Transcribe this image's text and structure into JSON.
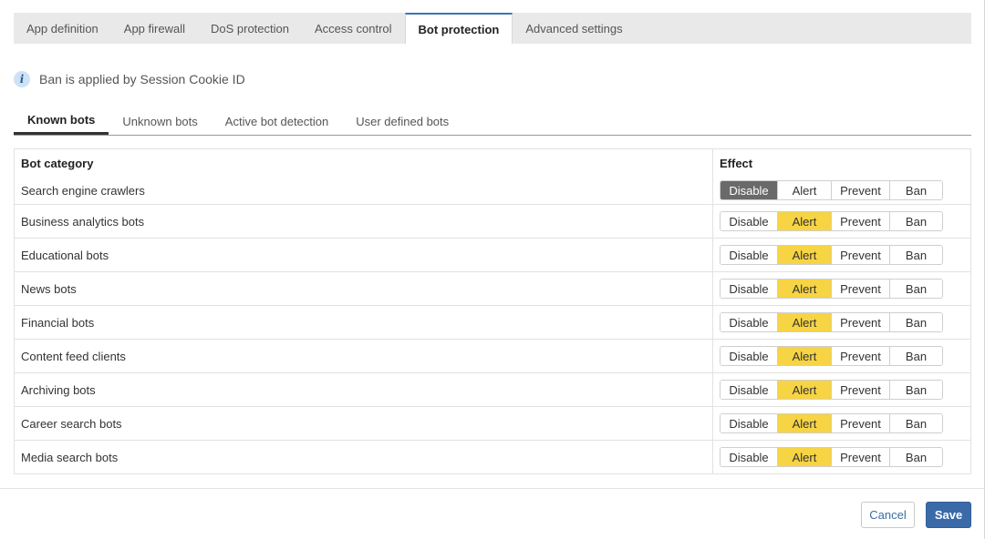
{
  "top_tabs": [
    {
      "label": "App definition"
    },
    {
      "label": "App firewall"
    },
    {
      "label": "DoS protection"
    },
    {
      "label": "Access control"
    },
    {
      "label": "Bot protection",
      "active": true
    },
    {
      "label": "Advanced settings"
    }
  ],
  "info": {
    "icon": "info-icon",
    "text": "Ban is applied by Session Cookie ID"
  },
  "sub_tabs": [
    {
      "label": "Known bots",
      "active": true
    },
    {
      "label": "Unknown bots"
    },
    {
      "label": "Active bot detection"
    },
    {
      "label": "User defined bots"
    }
  ],
  "table": {
    "headers": {
      "category": "Bot category",
      "effect": "Effect"
    },
    "effect_options": [
      "Disable",
      "Alert",
      "Prevent",
      "Ban"
    ],
    "rows": [
      {
        "category": "Search engine crawlers",
        "effect": "Disable"
      },
      {
        "category": "Business analytics bots",
        "effect": "Alert"
      },
      {
        "category": "Educational bots",
        "effect": "Alert"
      },
      {
        "category": "News bots",
        "effect": "Alert"
      },
      {
        "category": "Financial bots",
        "effect": "Alert"
      },
      {
        "category": "Content feed clients",
        "effect": "Alert"
      },
      {
        "category": "Archiving bots",
        "effect": "Alert"
      },
      {
        "category": "Career search bots",
        "effect": "Alert"
      },
      {
        "category": "Media search bots",
        "effect": "Alert"
      }
    ]
  },
  "footer": {
    "cancel_label": "Cancel",
    "save_label": "Save"
  },
  "colors": {
    "accent": "#3b6aa9",
    "alert_selected": "#f6d443",
    "disable_selected": "#6a6a6a"
  }
}
